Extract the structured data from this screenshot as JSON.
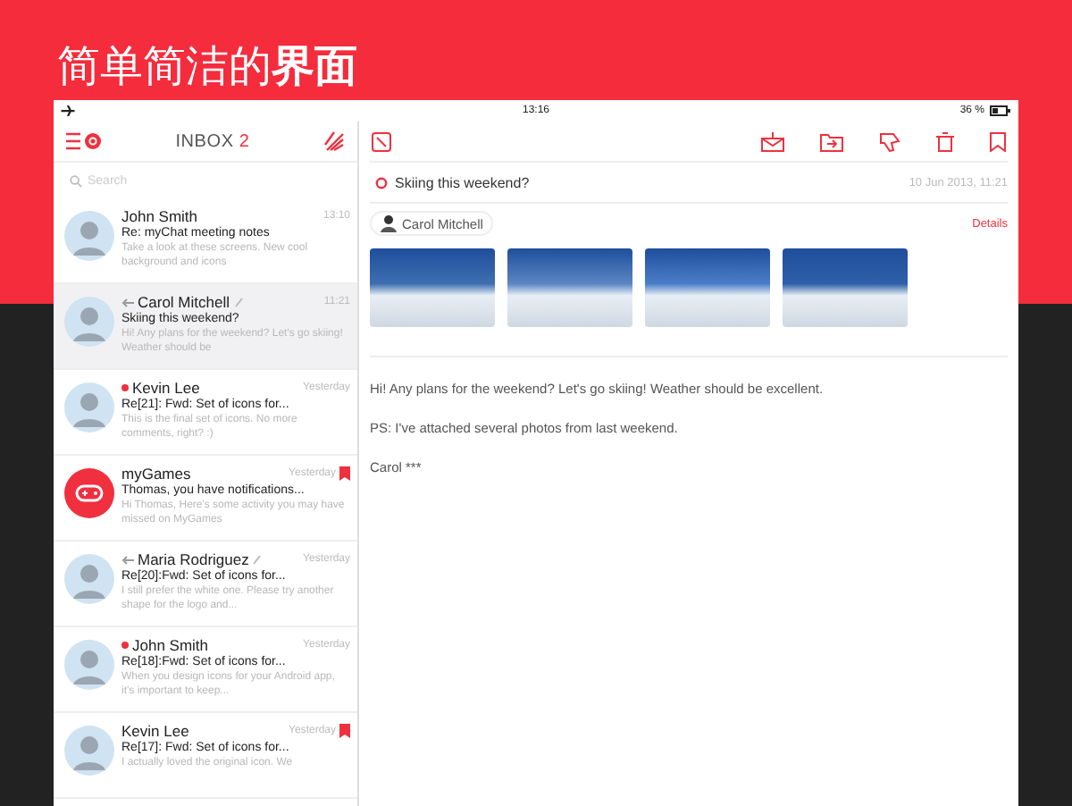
{
  "headline": "简单简洁的**界面**",
  "status_bar": {
    "time": "13:16",
    "battery": "36 %"
  },
  "sidebar": {
    "title": "INBOX",
    "count": "2",
    "search": {
      "placeholder": "Search"
    },
    "messages": [
      {
        "kind": "person",
        "name": "John Smith",
        "time": "13:10",
        "subject": "Re: myChat meeting notes",
        "preview": "Take a look at these screens. New cool background and icons",
        "unread": false,
        "replied": false,
        "attachment": false,
        "flagged": false,
        "selected": false
      },
      {
        "kind": "person",
        "name": "Carol Mitchell",
        "time": "11:21",
        "subject": "Skiing this weekend?",
        "preview": "Hi! Any plans for the weekend? Let's go skiing! Weather should be",
        "unread": false,
        "replied": true,
        "attachment": true,
        "flagged": false,
        "selected": true
      },
      {
        "kind": "person",
        "name": "Kevin Lee",
        "time": "Yesterday",
        "subject": "Re[21]: Fwd: Set of icons for...",
        "preview": "This is the final set of icons. No more comments, right? :)",
        "unread": true,
        "replied": false,
        "attachment": false,
        "flagged": false,
        "selected": false
      },
      {
        "kind": "app",
        "name": "myGames",
        "time": "Yesterday",
        "subject": "Thomas, you have notifications...",
        "preview": "Hi Thomas, Here's some activity you may have missed on MyGames",
        "unread": false,
        "replied": false,
        "attachment": false,
        "flagged": true,
        "selected": false
      },
      {
        "kind": "person",
        "name": "Maria Rodriguez",
        "time": "Yesterday",
        "subject": "Re[20]:Fwd:  Set of icons for...",
        "preview": "I still prefer the white one. Please try another shape for the logo and...",
        "unread": false,
        "replied": true,
        "attachment": true,
        "flagged": false,
        "selected": false
      },
      {
        "kind": "person",
        "name": "John Smith",
        "time": "Yesterday",
        "subject": "Re[18]:Fwd:  Set of icons for...",
        "preview": "When you design icons for your Android app, it's important to keep...",
        "unread": true,
        "replied": false,
        "attachment": false,
        "flagged": false,
        "selected": false
      },
      {
        "kind": "person",
        "name": "Kevin Lee",
        "time": "Yesterday",
        "subject": "Re[17]: Fwd: Set of icons for...",
        "preview": "I actually loved the original icon. We",
        "unread": false,
        "replied": false,
        "attachment": false,
        "flagged": true,
        "selected": false
      }
    ]
  },
  "message": {
    "subject": "Skiing this weekend?",
    "date": "10 Jun 2013, 11:21",
    "sender": "Carol Mitchell",
    "details": "Details",
    "body": [
      "Hi! Any plans for the weekend? Let's go skiing! Weather should be excellent.",
      "PS: I've attached several photos from last weekend.",
      "Carol ***"
    ]
  }
}
